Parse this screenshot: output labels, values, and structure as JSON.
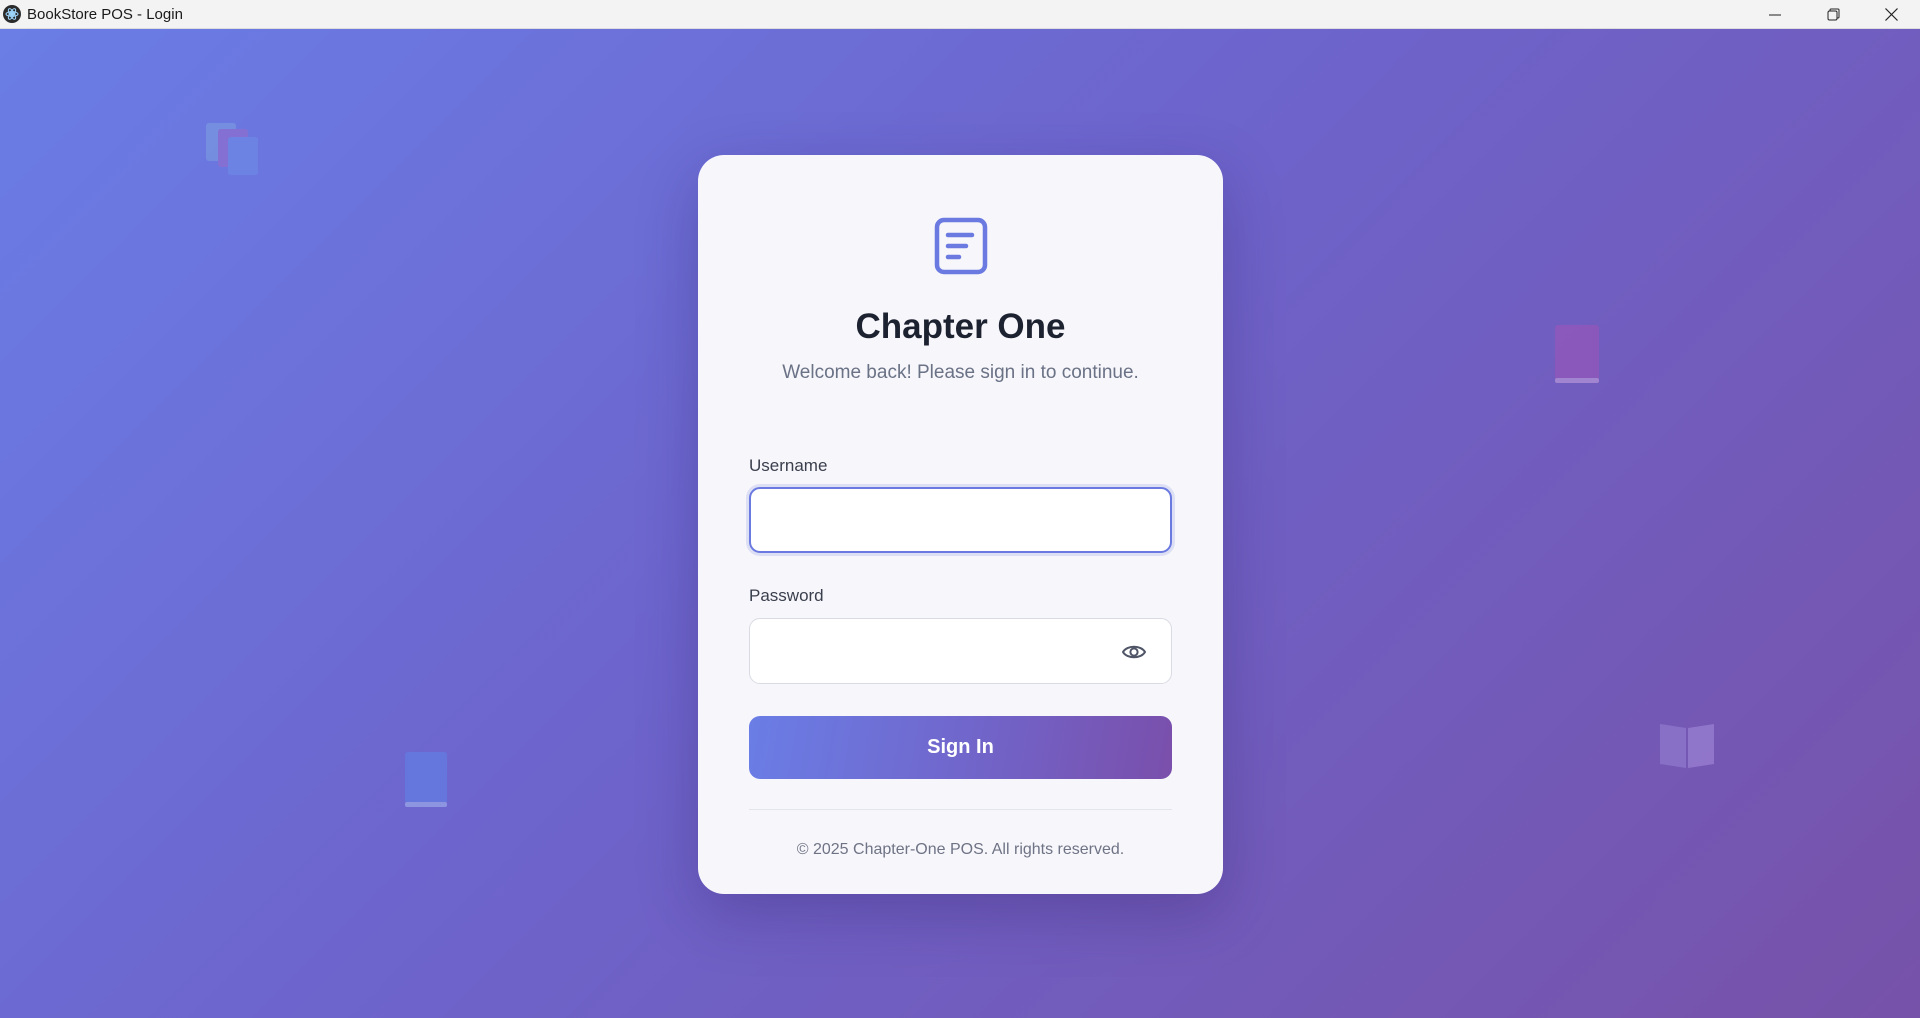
{
  "window": {
    "title": "BookStore POS - Login",
    "controls": [
      "minimize-icon",
      "restore-icon",
      "close-icon"
    ]
  },
  "login": {
    "brand_title": "Chapter One",
    "subtitle": "Welcome back! Please sign in to continue.",
    "username_label": "Username",
    "username_value": "",
    "password_label": "Password",
    "password_value": "",
    "signin_label": "Sign In",
    "footer": "© 2025 Chapter-One POS. All rights reserved."
  },
  "icons": {
    "logo": "document-icon",
    "password_toggle": "eye-icon"
  },
  "colors": {
    "accent": "#6b7ae0",
    "gradient_start": "#6a7ee6",
    "gradient_end": "#7752a9",
    "card_bg": "#f7f6fb",
    "title_text": "#1d2231"
  }
}
